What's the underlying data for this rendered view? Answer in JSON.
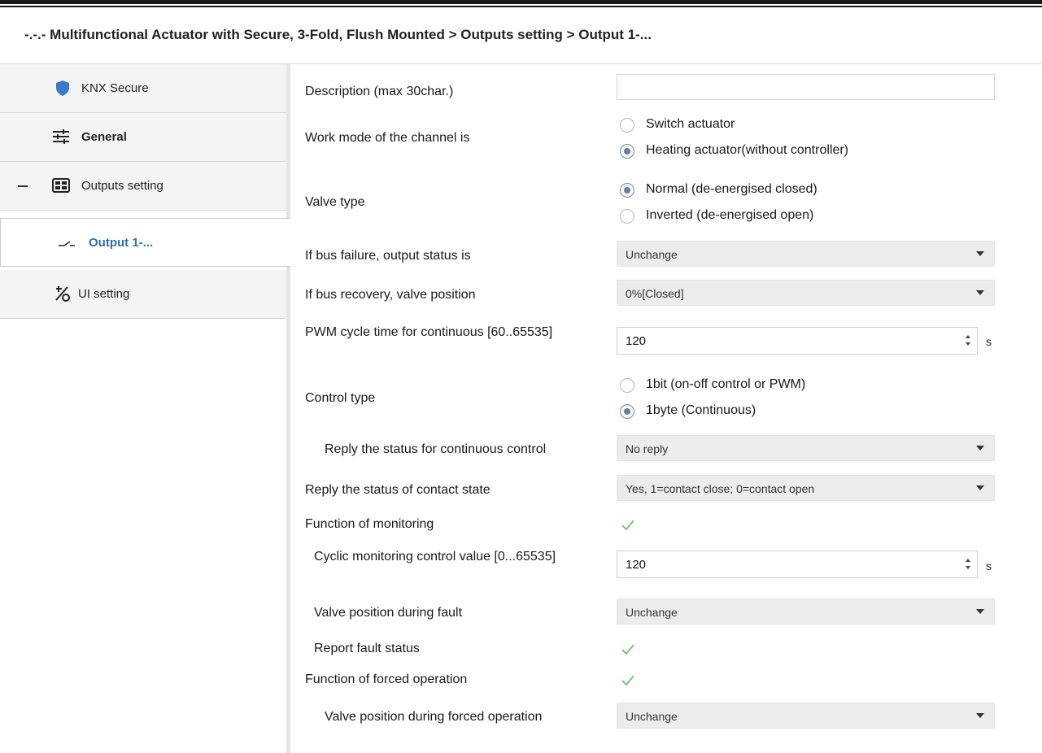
{
  "header": {
    "breadcrumb": "-.-.- Multifunctional Actuator with Secure, 3-Fold, Flush Mounted > Outputs setting > Output 1-..."
  },
  "sidebar": {
    "items": [
      {
        "label": "KNX Secure",
        "icon": "shield-icon"
      },
      {
        "label": "General",
        "icon": "sliders-icon"
      },
      {
        "label": "Outputs setting",
        "icon": "grid-icon"
      },
      {
        "label": "Output 1-...",
        "icon": "switch-contact-icon"
      },
      {
        "label": "UI setting",
        "icon": "ui-setting-icon"
      }
    ]
  },
  "form": {
    "description": {
      "label": "Description (max 30char.)",
      "value": ""
    },
    "work_mode": {
      "label": "Work mode of the channel is",
      "options": [
        "Switch actuator",
        "Heating actuator(without controller)"
      ],
      "selected": "Heating actuator(without controller)"
    },
    "valve_type": {
      "label": "Valve type",
      "options": [
        "Normal (de-energised closed)",
        "Inverted (de-energised open)"
      ],
      "selected": "Normal (de-energised closed)"
    },
    "bus_failure": {
      "label": "If bus failure, output status is",
      "value": "Unchange"
    },
    "bus_recovery": {
      "label": "If bus recovery, valve position",
      "value": "0%[Closed]"
    },
    "pwm_cycle": {
      "label": "PWM cycle time for continuous [60..65535]",
      "value": "120",
      "unit": "s"
    },
    "control_type": {
      "label": "Control type",
      "options": [
        "1bit (on-off control or PWM)",
        "1byte (Continuous)"
      ],
      "selected": "1byte (Continuous)"
    },
    "reply_continuous": {
      "label": "Reply the status for continuous control",
      "value": "No reply"
    },
    "reply_contact": {
      "label": "Reply the status of contact state",
      "value": "Yes, 1=contact close; 0=contact open"
    },
    "monitoring": {
      "label": "Function of monitoring",
      "checked": true
    },
    "cyclic_monitoring": {
      "label": "Cyclic monitoring control value [0...65535]",
      "value": "120",
      "unit": "s"
    },
    "valve_fault": {
      "label": "Valve position during fault",
      "value": "Unchange"
    },
    "report_fault": {
      "label": "Report fault status",
      "checked": true
    },
    "forced_operation": {
      "label": "Function of forced operation",
      "checked": true
    },
    "valve_forced": {
      "label": "Valve position during forced operation",
      "value": "Unchange"
    }
  },
  "colors": {
    "active_item": "#2a6fb0",
    "shield": "#3a78c8",
    "check": "#7cc47c"
  }
}
